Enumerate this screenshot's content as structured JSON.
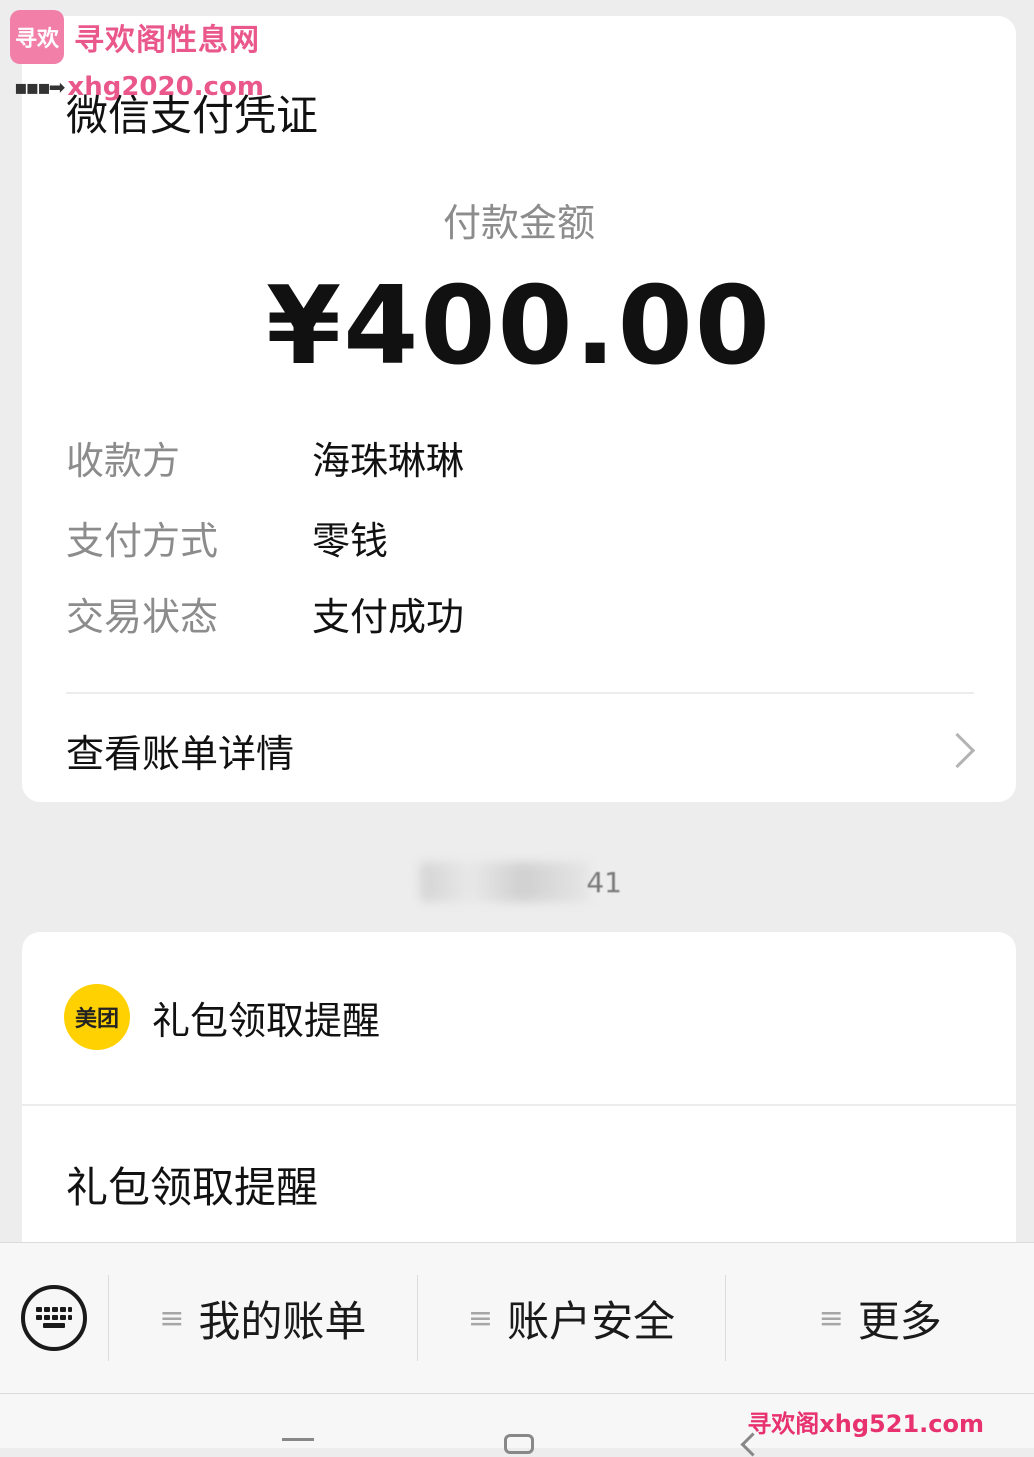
{
  "watermark": {
    "logo_text": "寻欢",
    "site_name": "寻欢阁性息网",
    "url": "xhg2020.com",
    "bottom": "寻欢阁xhg521.com"
  },
  "voucher": {
    "title": "微信支付凭证",
    "amount_label": "付款金额",
    "amount": "¥400.00",
    "rows": [
      {
        "key": "收款方",
        "value": "海珠琳琳"
      },
      {
        "key": "支付方式",
        "value": "零钱"
      },
      {
        "key": "交易状态",
        "value": "支付成功"
      }
    ],
    "detail_link": "查看账单详情"
  },
  "timestamp": {
    "visible_text": "41"
  },
  "promo": {
    "icon_text": "美团",
    "name": "礼包领取提醒",
    "body": "礼包领取提醒"
  },
  "menu": {
    "items": [
      {
        "label": "我的账单"
      },
      {
        "label": "账户安全"
      },
      {
        "label": "更多"
      }
    ]
  },
  "colors": {
    "background": "#ededed",
    "card": "#ffffff",
    "muted_text": "#8c8c8c",
    "meituan_yellow": "#ffd100",
    "watermark_pink": "#e9578b"
  }
}
